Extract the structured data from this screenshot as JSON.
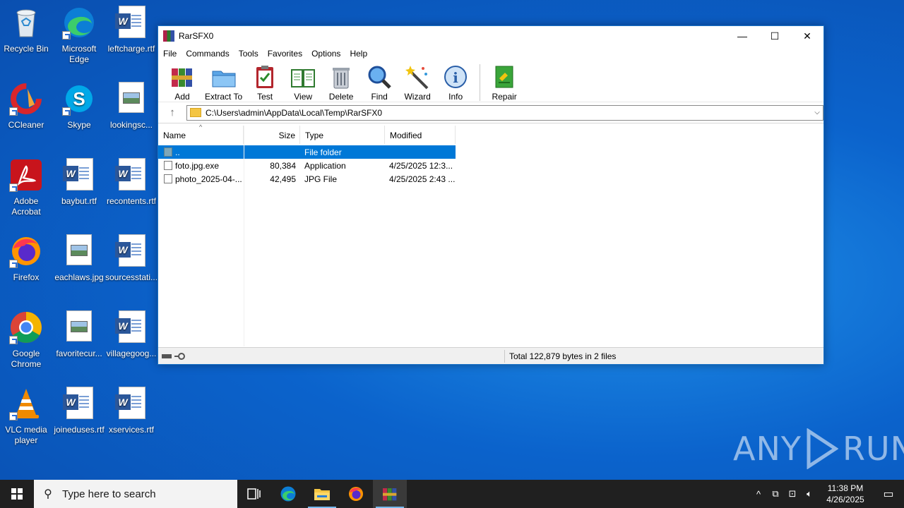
{
  "desktop": {
    "icons": [
      {
        "label": "Recycle Bin",
        "icon": "recycle-bin-icon"
      },
      {
        "label": "Microsoft Edge",
        "icon": "edge-icon"
      },
      {
        "label": "leftcharge.rtf",
        "icon": "word-doc-icon"
      },
      {
        "label": "CCleaner",
        "icon": "ccleaner-icon"
      },
      {
        "label": "Skype",
        "icon": "skype-icon"
      },
      {
        "label": "lookingsc...",
        "icon": "image-file-icon"
      },
      {
        "label": "Adobe Acrobat",
        "icon": "acrobat-icon"
      },
      {
        "label": "baybut.rtf",
        "icon": "word-doc-icon"
      },
      {
        "label": "recontents.rtf",
        "icon": "word-doc-icon"
      },
      {
        "label": "Firefox",
        "icon": "firefox-icon"
      },
      {
        "label": "eachlaws.jpg",
        "icon": "image-file-icon"
      },
      {
        "label": "sourcesstati...",
        "icon": "word-doc-icon"
      },
      {
        "label": "Google Chrome",
        "icon": "chrome-icon"
      },
      {
        "label": "favoritecur...",
        "icon": "image-file-icon"
      },
      {
        "label": "villagegoog...",
        "icon": "word-doc-icon"
      },
      {
        "label": "VLC media player",
        "icon": "vlc-icon"
      },
      {
        "label": "joineduses.rtf",
        "icon": "word-doc-icon"
      },
      {
        "label": "xservices.rtf",
        "icon": "word-doc-icon"
      }
    ]
  },
  "window": {
    "title": "RarSFX0",
    "controls": {
      "minimize": "—",
      "maximize": "☐",
      "close": "✕"
    },
    "menu": [
      "File",
      "Commands",
      "Tools",
      "Favorites",
      "Options",
      "Help"
    ],
    "toolbar": [
      "Add",
      "Extract To",
      "Test",
      "View",
      "Delete",
      "Find",
      "Wizard",
      "Info",
      "Repair"
    ],
    "address": {
      "path": "C:\\Users\\admin\\AppData\\Local\\Temp\\RarSFX0"
    },
    "columns": {
      "name": "Name",
      "size": "Size",
      "type": "Type",
      "modified": "Modified"
    },
    "rows": [
      {
        "name": "..",
        "size": "",
        "type": "File folder",
        "modified": ""
      },
      {
        "name": "foto.jpg.exe",
        "size": "80,384",
        "type": "Application",
        "modified": "4/25/2025 12:3..."
      },
      {
        "name": "photo_2025-04-...",
        "size": "42,495",
        "type": "JPG File",
        "modified": "4/25/2025 2:43 ..."
      }
    ],
    "status": "Total 122,879 bytes in 2 files"
  },
  "taskbar": {
    "search_placeholder": "Type here to search",
    "time": "11:38 PM",
    "date": "4/26/2025"
  },
  "watermark": {
    "left": "ANY",
    "right": "RUN"
  },
  "colors": {
    "selection": "#0078d7",
    "taskbar": "#202020",
    "desktop": "#0b63cc"
  }
}
